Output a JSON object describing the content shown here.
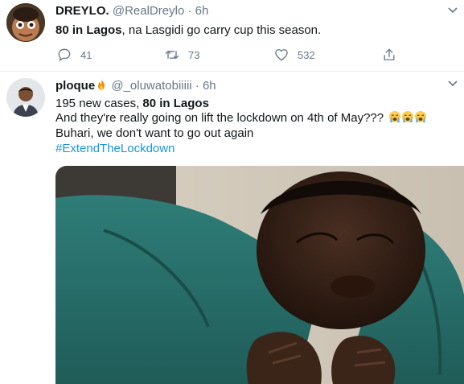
{
  "tweets": [
    {
      "display_name": "DREYLO.",
      "handle": "@RealDreylo",
      "separator": "·",
      "time": "6h",
      "text_bold": "80 in Lagos",
      "text_rest": ", na Lasgidi go carry cup this season.",
      "replies": "41",
      "retweets": "73",
      "likes": "532"
    },
    {
      "display_name": "ploque",
      "name_emoji": "fire-emoji",
      "handle": "@_oluwatobiiiii",
      "separator": "·",
      "time": "6h",
      "line1_plain": "195 new cases, ",
      "line1_bold": "80 in Lagos",
      "line2": "And they're really going on lift the lockdown on 4th of May???",
      "line2_emoji": "loudly-crying-face-emoji",
      "line3": "Buhari, we don't want to go out again",
      "hashtag": "#ExtendTheLockdown"
    }
  ],
  "colors": {
    "accent": "#1b95e0",
    "secondary_text": "#657786",
    "divider": "#e6ecf0"
  }
}
